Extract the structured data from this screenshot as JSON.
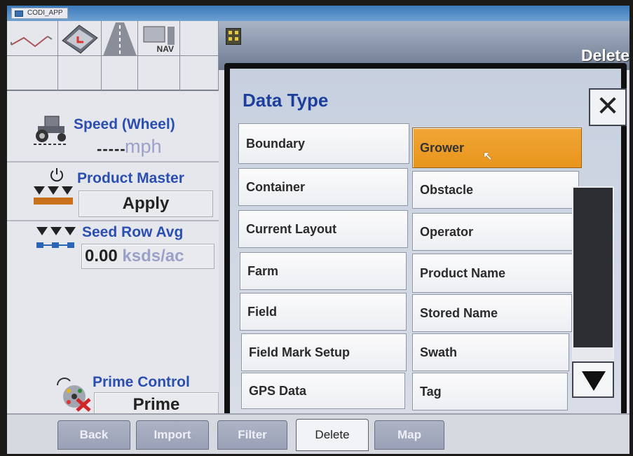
{
  "window": {
    "app_title": "CODI_APP"
  },
  "header": {
    "page_title": "Delete"
  },
  "toolbar": {
    "nav_label": "NAV"
  },
  "speed": {
    "label": "Speed (Wheel)",
    "value": "-----",
    "unit": "mph"
  },
  "product_master": {
    "label": "Product Master",
    "button": "Apply"
  },
  "seed_row": {
    "label": "Seed Row Avg",
    "value": "0.00",
    "unit": "ksds/ac"
  },
  "prime_control": {
    "label": "Prime Control",
    "button": "Prime"
  },
  "dialog": {
    "title": "Data Type",
    "close": "✕",
    "left_items": [
      "Boundary",
      "Container",
      "Current Layout",
      "Farm",
      "Field",
      "Field Mark Setup",
      "GPS Data"
    ],
    "right_items": [
      "Grower",
      "Obstacle",
      "Operator",
      "Product Name",
      "Stored Name",
      "Swath",
      "Tag"
    ],
    "selected": "Grower"
  },
  "tabs": [
    "Back",
    "Import",
    "Filter",
    "Delete",
    "Map"
  ],
  "active_tab": "Delete",
  "colors": {
    "selected_item": "#e8951c",
    "title_blue": "#1d3f9c",
    "label_blue": "#2a4fb0"
  },
  "icons": [
    "tractor-icon",
    "power-icon",
    "seed-meter-icon",
    "row-unit-icon",
    "prime-icon",
    "scroll-down-icon",
    "close-icon",
    "cursor-icon"
  ]
}
